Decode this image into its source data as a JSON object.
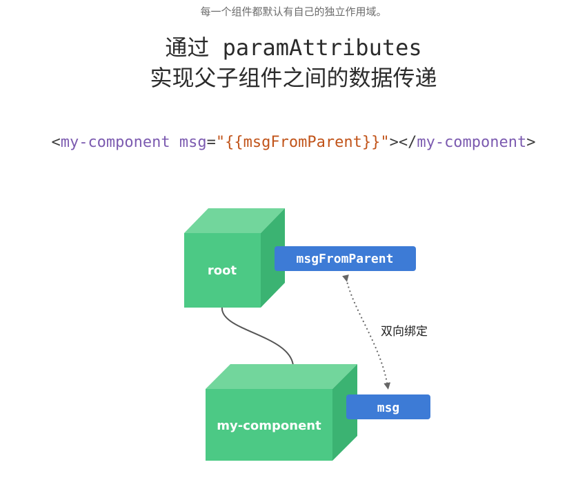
{
  "caption": "每一个组件都默认有自己的独立作用域。",
  "title": {
    "line1_prefix": "通过",
    "line1_code": "paramAttributes",
    "line2": "实现父子组件之间的数据传递"
  },
  "code": {
    "open_lt": "<",
    "tag_name": "my-component",
    "attr": "msg",
    "eq": "=",
    "quote_open": "\"",
    "value": "{{msgFromParent}}",
    "quote_close": "\"",
    "open_gt": "></",
    "close_tag_name": "my-component",
    "close_gt": ">"
  },
  "diagram": {
    "root_label": "root",
    "child_label": "my-component",
    "parent_prop": "msgFromParent",
    "child_prop": "msg",
    "binding_label": "双向绑定",
    "colors": {
      "cube_front": "#4cc985",
      "cube_top": "#72d69c",
      "cube_side": "#3bb372",
      "pill": "#3d7bd6",
      "connector": "#555555",
      "arrow": "#666666"
    }
  }
}
